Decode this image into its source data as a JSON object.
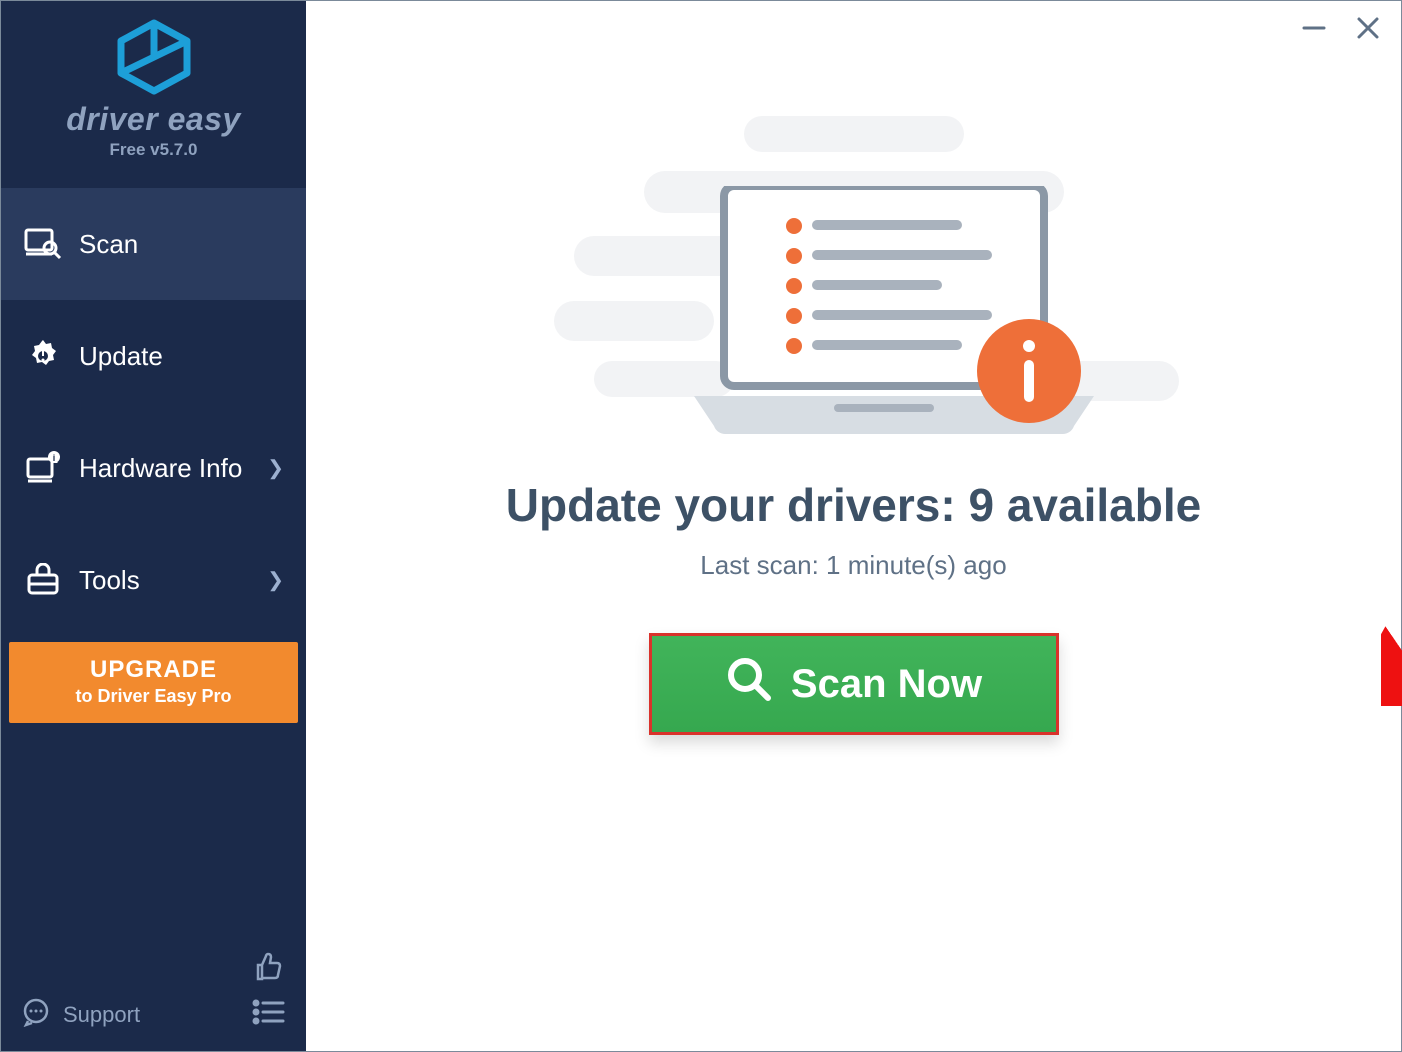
{
  "brand": {
    "name": "driver easy",
    "version": "Free v5.7.0"
  },
  "sidebar": {
    "items": [
      {
        "label": "Scan"
      },
      {
        "label": "Update"
      },
      {
        "label": "Hardware Info"
      },
      {
        "label": "Tools"
      }
    ],
    "upgrade": {
      "line1": "UPGRADE",
      "line2": "to Driver Easy Pro"
    },
    "support_label": "Support"
  },
  "main": {
    "headline": "Update your drivers: 9 available",
    "subline": "Last scan: 1 minute(s) ago",
    "scan_button": "Scan Now"
  },
  "colors": {
    "sidebar_bg": "#1b2a4a",
    "accent_orange": "#f28a2e",
    "scan_green": "#3fb257",
    "heading": "#3d5166"
  }
}
